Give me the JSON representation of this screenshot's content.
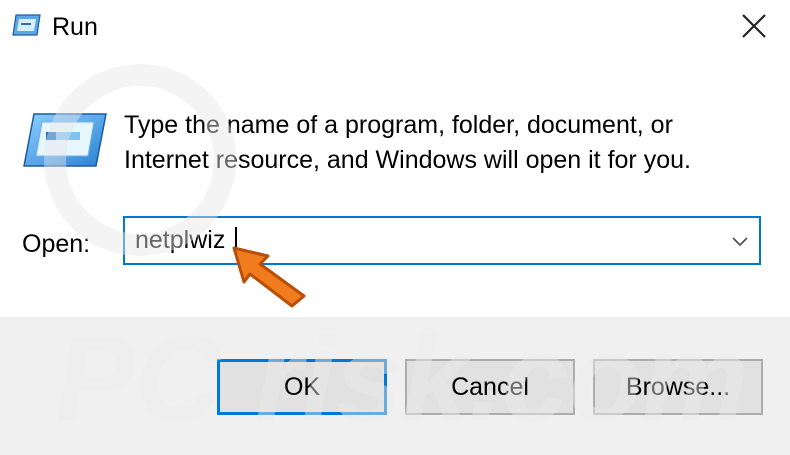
{
  "window": {
    "title": "Run",
    "icon": "run-icon",
    "close_icon": "close-icon"
  },
  "body": {
    "icon": "run-program-icon",
    "description_line1": "Type the name of a program, folder, document, or",
    "description_line2": "Internet resource, and Windows will open it for you.",
    "open_label": "Open:",
    "open_value": "netplwiz",
    "dropdown_icon": "chevron-down-icon"
  },
  "buttons": {
    "ok": "OK",
    "cancel": "Cancel",
    "browse": "Browse..."
  },
  "watermark": {
    "text": "PC risk.com"
  },
  "colors": {
    "accent": "#0078d7",
    "footer_bg": "#f0f0f0",
    "button_bg": "#e1e1e1",
    "button_border": "#adadad",
    "annotation_arrow": "#f07c1e"
  }
}
